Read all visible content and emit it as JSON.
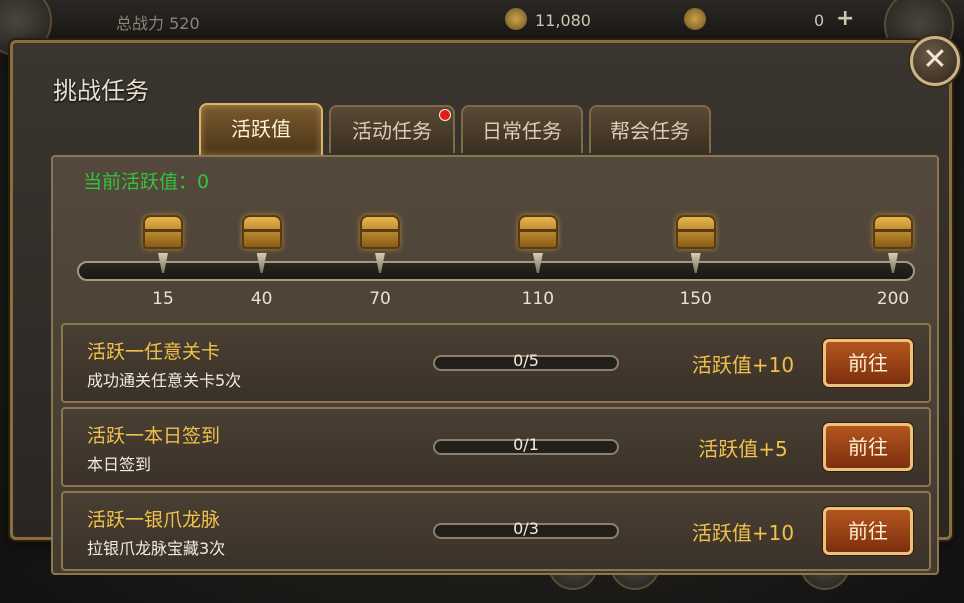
{
  "hud": {
    "power_text": "总战力 520",
    "gold": "11,080",
    "gem": "0",
    "plus_symbol": "+"
  },
  "dialog": {
    "title": "挑战任务",
    "close_symbol": "✕",
    "tabs": [
      {
        "label": "活跃值",
        "active": true,
        "has_dot": false
      },
      {
        "label": "活动任务",
        "active": false,
        "has_dot": true
      },
      {
        "label": "日常任务",
        "active": false,
        "has_dot": false
      },
      {
        "label": "帮会任务",
        "active": false,
        "has_dot": false
      }
    ],
    "current_activity_label": "当前活跃值：0",
    "current_activity": 0,
    "max_activity": 200,
    "milestones": [
      "15",
      "40",
      "70",
      "110",
      "150",
      "200"
    ],
    "tasks": [
      {
        "name": "活跃一任意关卡",
        "desc": "成功通关任意关卡5次",
        "progress": "0/5",
        "done": 0,
        "total": 5,
        "reward": "活跃值+10",
        "button": "前往"
      },
      {
        "name": "活跃一本日签到",
        "desc": "本日签到",
        "progress": "0/1",
        "done": 0,
        "total": 1,
        "reward": "活跃值+5",
        "button": "前往"
      },
      {
        "name": "活跃一银爪龙脉",
        "desc": "拉银爪龙脉宝藏3次",
        "progress": "0/3",
        "done": 0,
        "total": 3,
        "reward": "活跃值+10",
        "button": "前往"
      }
    ]
  },
  "colors": {
    "accent_gold": "#f0c24c",
    "active_green": "#36c23d",
    "notify_red": "#e21c1c"
  }
}
